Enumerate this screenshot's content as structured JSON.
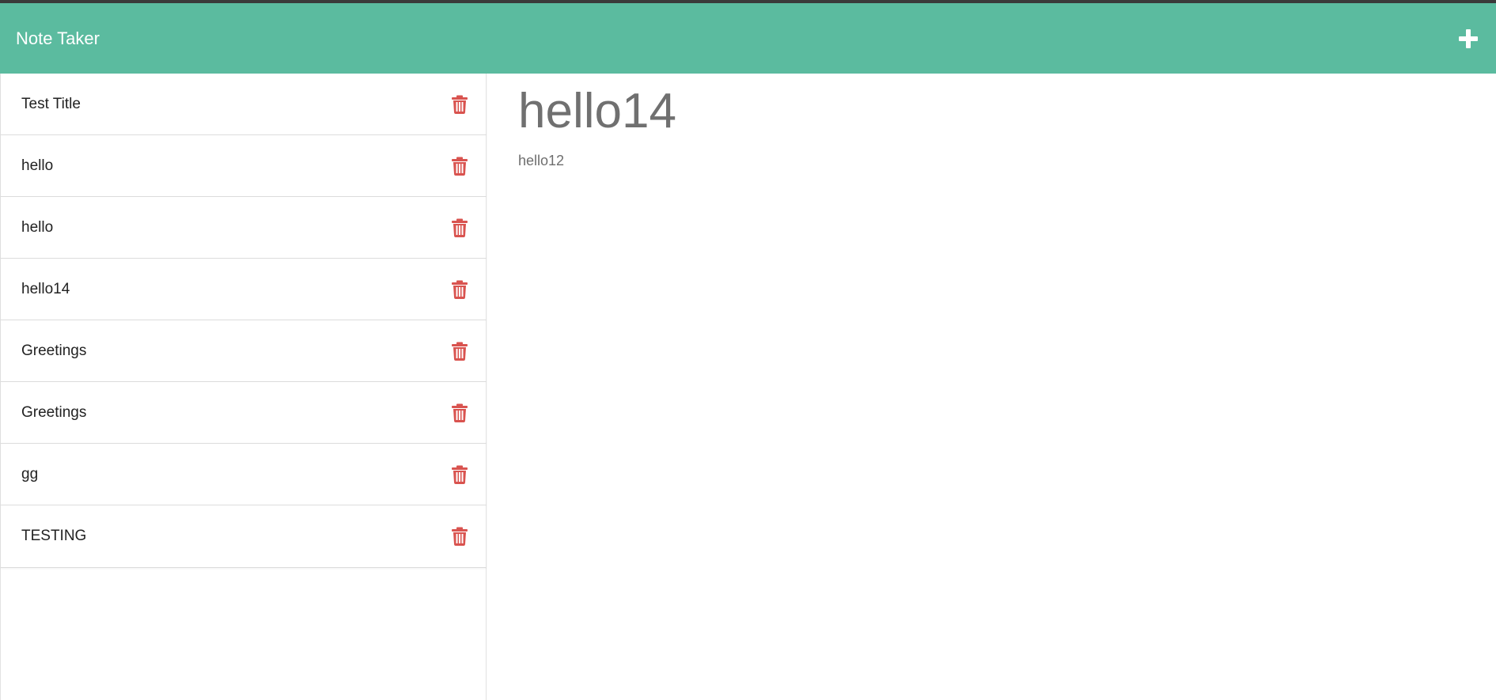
{
  "navbar": {
    "brand": "Note Taker",
    "add_icon": "plus-icon",
    "background_color": "#5bbb9f"
  },
  "sidebar": {
    "notes": [
      {
        "title": "Test Title",
        "delete_icon": "trash-icon"
      },
      {
        "title": "hello",
        "delete_icon": "trash-icon"
      },
      {
        "title": "hello",
        "delete_icon": "trash-icon"
      },
      {
        "title": "hello14",
        "delete_icon": "trash-icon"
      },
      {
        "title": "Greetings",
        "delete_icon": "trash-icon"
      },
      {
        "title": "Greetings",
        "delete_icon": "trash-icon"
      },
      {
        "title": "gg",
        "delete_icon": "trash-icon"
      },
      {
        "title": "TESTING",
        "delete_icon": "trash-icon"
      }
    ],
    "delete_color": "#d9534f"
  },
  "editor": {
    "title": "hello14",
    "body": "hello12"
  }
}
